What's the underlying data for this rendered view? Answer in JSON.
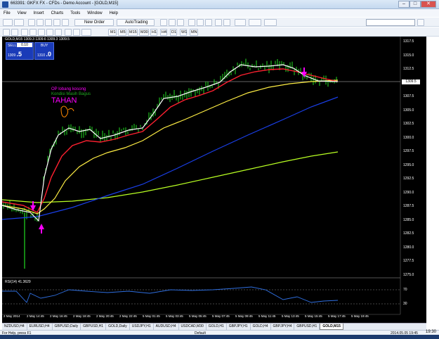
{
  "window": {
    "title": "663391: GKFX FX - CFDs - Demo Account - [GOLD,M15]",
    "min": "–",
    "max": "□",
    "close": "✕"
  },
  "menu": [
    "File",
    "View",
    "Insert",
    "Charts",
    "Tools",
    "Window",
    "Help"
  ],
  "toolbar": {
    "new_order": "New Order",
    "autotrading": "AutoTrading",
    "timeframes": [
      "M1",
      "M5",
      "M15",
      "M30",
      "H1",
      "H4",
      "D1",
      "W1",
      "MN"
    ]
  },
  "chart": {
    "header": "GOLD,M15  1309.3 1309.6 1309.3 1309.5",
    "trade": {
      "sell_label": "SELL",
      "buy_label": "BUY",
      "lot": "0.10",
      "sell_price_small": "1309",
      "sell_price_big": ".5",
      "buy_price_small": "1310",
      "buy_price_big": ".0"
    },
    "annotations": {
      "line1": "OP lobang kosong",
      "line2": "Kondisi Masih Bagus",
      "line3": "TAHAN"
    },
    "current_price": "1309.5",
    "y_ticks": [
      "1317.5",
      "1315.0",
      "1312.5",
      "1310.0",
      "1307.5",
      "1305.0",
      "1302.5",
      "1300.0",
      "1297.5",
      "1295.0",
      "1292.5",
      "1290.0",
      "1287.5",
      "1285.0",
      "1282.5",
      "1280.0",
      "1277.5",
      "1275.0"
    ],
    "rsi_label": "RSI(14) 41.3629",
    "rsi_ticks": [
      "70",
      "30"
    ],
    "x_ticks": [
      "2 May 2014",
      "2 May 14:45",
      "2 May 16:45",
      "2 May 18:45",
      "2 May 20:45",
      "2 May 22:45",
      "5 May 01:45",
      "5 May 03:45",
      "5 May 05:45",
      "5 May 07:45",
      "5 May 09:45",
      "5 May 11:45",
      "5 May 13:45",
      "5 May 15:45",
      "5 May 17:45",
      "5 May 19:45"
    ]
  },
  "tabs": [
    "NZDUSD,H4",
    "EURUSD,H4",
    "GBPUSD,Daily",
    "GBPUSD,H1",
    "GOLD,Daily",
    "USDJPY,H1",
    "AUDUSD,H4",
    "USDCAD,M30",
    "GOLD,H1",
    "GBPJPY,H1",
    "GOLD,H4",
    "GBPJPY,H4",
    "GBPUSD,H1",
    "GOLD,M15"
  ],
  "active_tab": "GOLD,M15",
  "status": {
    "left": "For Help, press F1",
    "mid": "Default",
    "right": "2014.05.05 19:45",
    "clock": "19:30"
  },
  "colors": {
    "chart_bg": "#000000",
    "candle": "#22dd22",
    "ma_fast": "#ffffff",
    "ma_red": "#ff2030",
    "ma_yellow": "#ffee44",
    "ma_blue": "#1a3fe8",
    "ma_lime": "#b8ff22",
    "rsi": "#2f6fe0",
    "annotation": "#ff00ff"
  }
}
